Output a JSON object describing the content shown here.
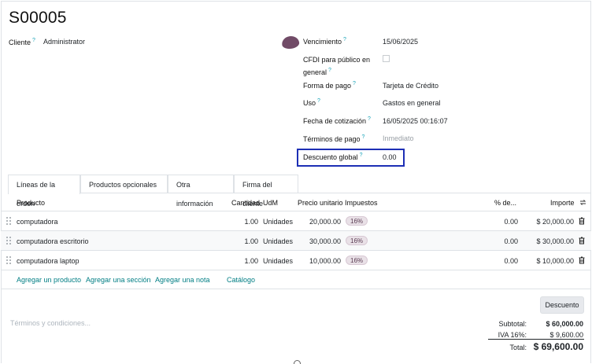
{
  "record": {
    "title": "S00005"
  },
  "left_fields": {
    "cliente_label": "Cliente",
    "cliente_help": "?",
    "cliente_value": "Administrator"
  },
  "right_fields": [
    {
      "label": "Vencimiento",
      "help": "?",
      "value": "15/06/2025"
    },
    {
      "label_line1": "CFDI para público en",
      "label_line2": "general",
      "help": "?",
      "value": ""
    },
    {
      "label": "Forma de pago",
      "help": "?",
      "value": "Tarjeta de Crédito"
    },
    {
      "label": "Uso",
      "help": "?",
      "value": "Gastos en general"
    },
    {
      "label": "Fecha de cotización",
      "help": "?",
      "value": "16/05/2025 00:16:07"
    },
    {
      "label": "Términos de pago",
      "help": "?",
      "value": "Inmediato"
    },
    {
      "label": "Descuento global",
      "help": "?",
      "value": "0.00"
    }
  ],
  "tabs": [
    "Líneas de la orden",
    "Productos opcionales",
    "Otra información",
    "Firma del cliente"
  ],
  "table": {
    "headers": {
      "producto": "Producto",
      "cantidad": "Cantidad",
      "udm": "UdM",
      "precio": "Precio unitario",
      "impuestos": "Impuestos",
      "descuento": "% de...",
      "importe": "Importe"
    },
    "rows": [
      {
        "producto": "computadora",
        "cantidad": "1.00",
        "udm": "Unidades",
        "precio": "20,000.00",
        "impuesto": "16%",
        "descuento": "0.00",
        "importe": "$ 20,000.00"
      },
      {
        "producto": "computadora escritorio",
        "cantidad": "1.00",
        "udm": "Unidades",
        "precio": "30,000.00",
        "impuesto": "16%",
        "descuento": "0.00",
        "importe": "$ 30,000.00"
      },
      {
        "producto": "computadora laptop",
        "cantidad": "1.00",
        "udm": "Unidades",
        "precio": "10,000.00",
        "impuesto": "16%",
        "descuento": "0.00",
        "importe": "$ 10,000.00"
      }
    ],
    "add_links": [
      "Agregar un producto",
      "Agregar una sección",
      "Agregar una nota",
      "Catálogo"
    ]
  },
  "footer": {
    "descuento_button": "Descuento",
    "terms_placeholder": "Términos y condiciones...",
    "subtotal_label": "Subtotal:",
    "subtotal_value": "$ 60,000.00",
    "iva_label": "IVA 16%:",
    "iva_value": "$ 9,600.00",
    "total_label": "Total:",
    "total_value": "$ 69,600.00"
  },
  "colors": {
    "accent": "#714b67",
    "link": "#017e84",
    "focus": "#1d2fb5"
  }
}
